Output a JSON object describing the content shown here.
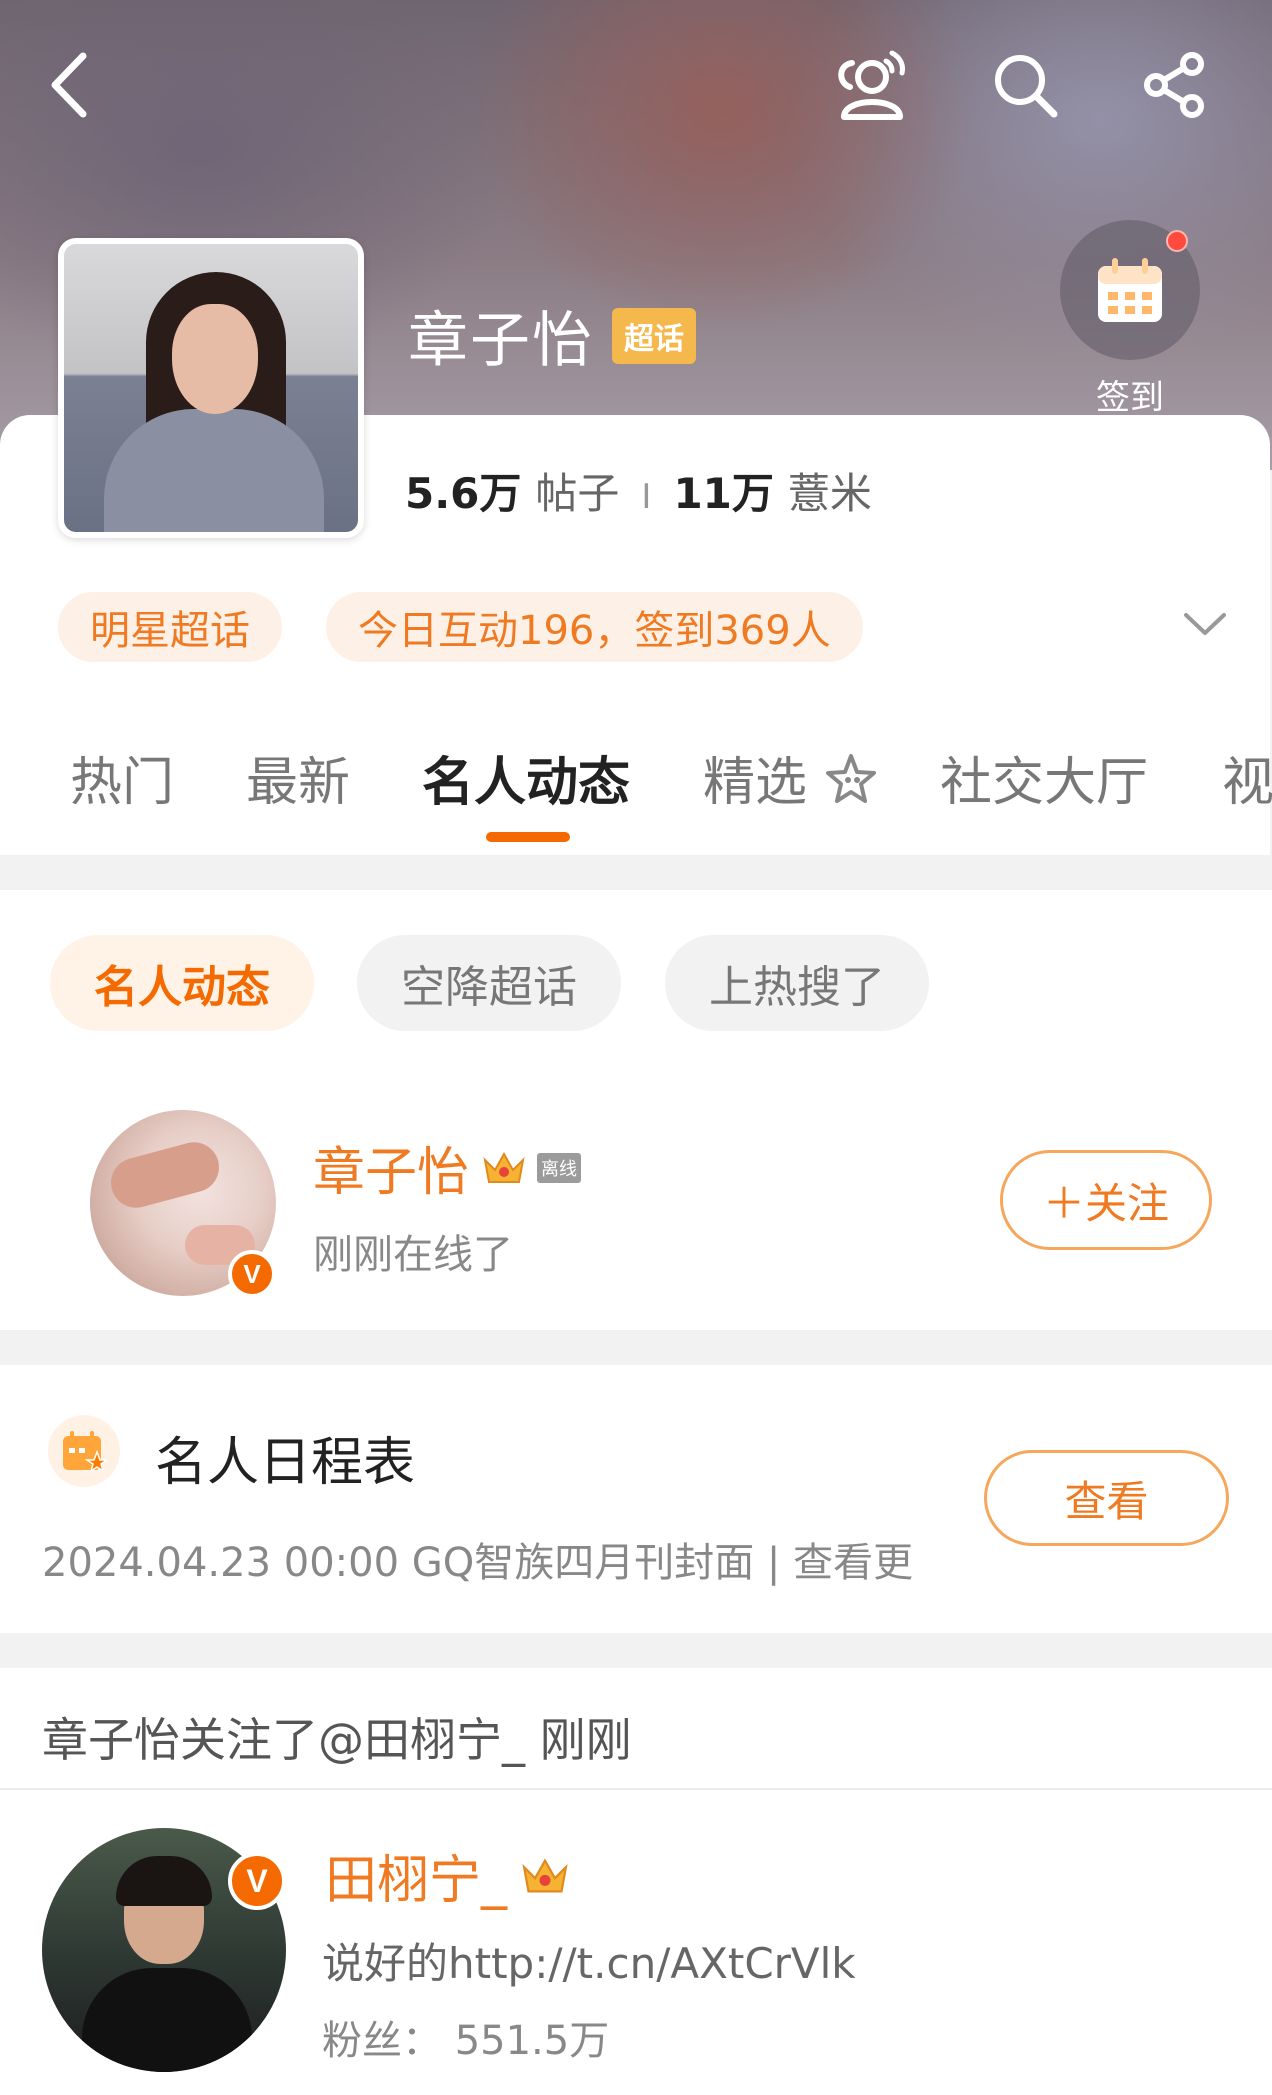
{
  "header": {
    "topic_name": "章子怡",
    "super_badge": "超话",
    "checkin_label": "签到",
    "icons": [
      "back-arrow-icon",
      "friends-icon",
      "search-icon",
      "share-icon",
      "calendar-icon"
    ]
  },
  "stats": {
    "posts_value": "5.6万",
    "posts_label": "帖子",
    "separator": "I",
    "fans_value": "11万",
    "fans_label": "薏米"
  },
  "chips": {
    "category": "明星超话",
    "today": "今日互动196，签到369人"
  },
  "tabs": [
    {
      "label": "热门"
    },
    {
      "label": "最新"
    },
    {
      "label": "名人动态"
    },
    {
      "label": "精选"
    },
    {
      "label": "社交大厅"
    },
    {
      "label": "视"
    }
  ],
  "active_tab": "名人动态",
  "subfilters": [
    "名人动态",
    "空降超话",
    "上热搜了"
  ],
  "celebrity": {
    "name": "章子怡",
    "status_badge": "离线",
    "status_text": "刚刚在线了",
    "follow_label": "＋关注",
    "verified_mark": "V"
  },
  "schedule": {
    "title": "名人日程表",
    "info": "2024.04.23 00:00 GQ智族四月刊封面 | 查看更",
    "view_label": "查看"
  },
  "activity": {
    "headline": "章子怡关注了@田栩宁_ 刚刚",
    "user_name": "田栩宁_",
    "description": "说好的http://t.cn/AXtCrVlk",
    "fans": "粉丝： 551.5万",
    "verified_mark": "V"
  },
  "colors": {
    "accent": "#f07a22",
    "accent_light": "#fdf0e6",
    "badge_gold": "#f4b84c",
    "notify_red": "#ff4a3d"
  }
}
